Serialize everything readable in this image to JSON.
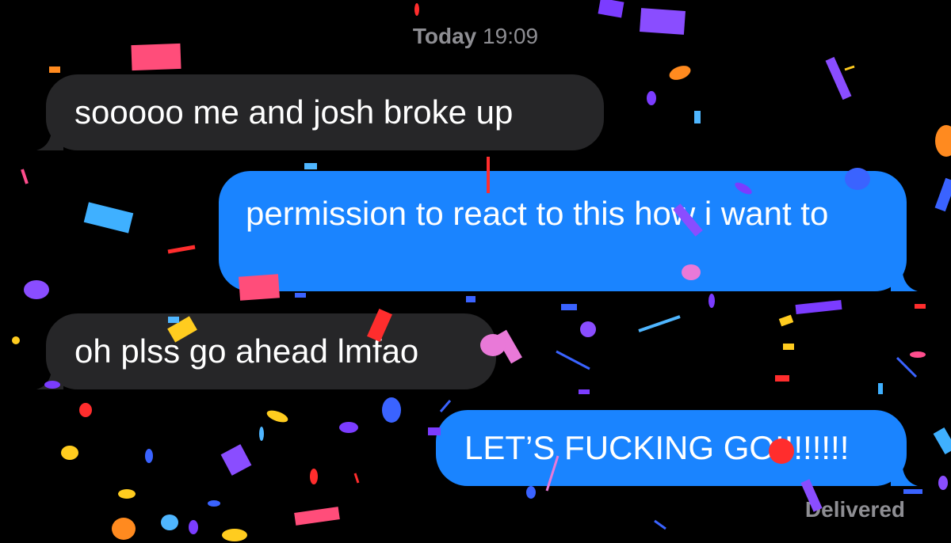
{
  "conversation": {
    "timestamp": {
      "day": "Today",
      "time": "19:09"
    },
    "messages": [
      {
        "direction": "received",
        "text": "sooooo me and josh broke up"
      },
      {
        "direction": "sent",
        "text": "permission to react to this how i want to"
      },
      {
        "direction": "received",
        "text": "oh plss go ahead lmfao"
      },
      {
        "direction": "sent",
        "text": "LET’S FUCKING GO!!!!!!!!"
      }
    ],
    "status": "Delivered",
    "effect": "confetti"
  },
  "colors": {
    "background": "#000000",
    "received_bubble": "#262628",
    "sent_bubble": "#1a84ff",
    "meta_text": "#8e8e93",
    "confetti_palette": [
      "#ff3b5c",
      "#ff4d8d",
      "#7b3cff",
      "#9b59ff",
      "#2a8cff",
      "#4fb6ff",
      "#ffcc1f",
      "#ff8a1f",
      "#ff2d2d",
      "#e979d8",
      "#3a63ff"
    ]
  }
}
